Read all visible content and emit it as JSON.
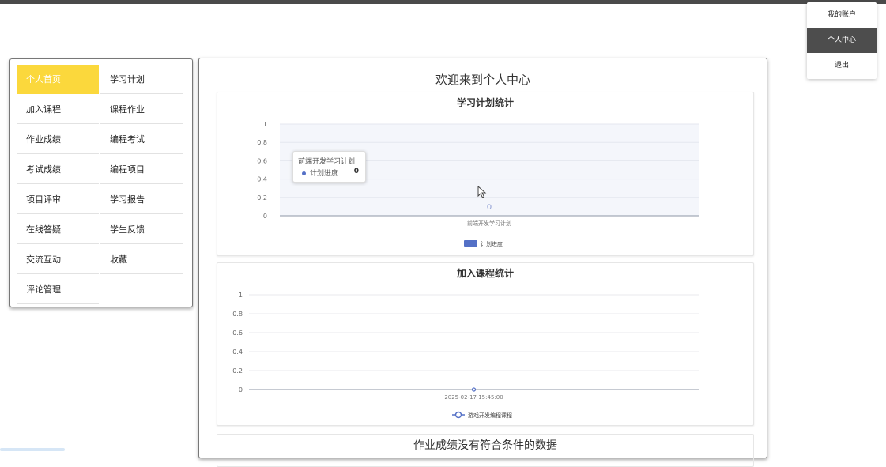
{
  "account_menu": {
    "items": [
      "我的账户",
      "个人中心",
      "退出"
    ],
    "active_index": 1
  },
  "side_menu": {
    "items": [
      "个人首页",
      "学习计划",
      "加入课程",
      "课程作业",
      "作业成绩",
      "编程考试",
      "考试成绩",
      "编程项目",
      "项目评审",
      "学习报告",
      "在线答疑",
      "学生反馈",
      "交流互动",
      "收藏",
      "评论管理"
    ],
    "active_index": 0
  },
  "main": {
    "title": "欢迎来到个人中心",
    "no_data_text": "作业成绩没有符合条件的数据"
  },
  "tooltip": {
    "title": "前端开发学习计划",
    "series": "计划进度",
    "value": "0"
  },
  "chart_data": [
    {
      "type": "bar",
      "title": "学习计划统计",
      "categories": [
        "前端开发学习计划"
      ],
      "series": [
        {
          "name": "计划进度",
          "values": [
            0
          ]
        }
      ],
      "ylim": [
        0,
        1
      ],
      "yticks": [
        "0",
        "0.2",
        "0.4",
        "0.6",
        "0.8",
        "1"
      ],
      "data_label": "0",
      "legend": "bottom-center",
      "color": "#5470c6"
    },
    {
      "type": "line",
      "title": "加入课程统计",
      "x": [
        "2025-02-17 15:45:00"
      ],
      "series": [
        {
          "name": "游戏开发编程课程",
          "values": [
            0
          ]
        }
      ],
      "ylim": [
        0,
        1
      ],
      "yticks": [
        "0",
        "0.2",
        "0.4",
        "0.6",
        "0.8",
        "1"
      ],
      "legend": "bottom-center",
      "color": "#5470c6"
    }
  ],
  "colors": {
    "accent": "#fbd83c",
    "series": "#5470c6",
    "dark_bar": "#4a4a4a"
  }
}
